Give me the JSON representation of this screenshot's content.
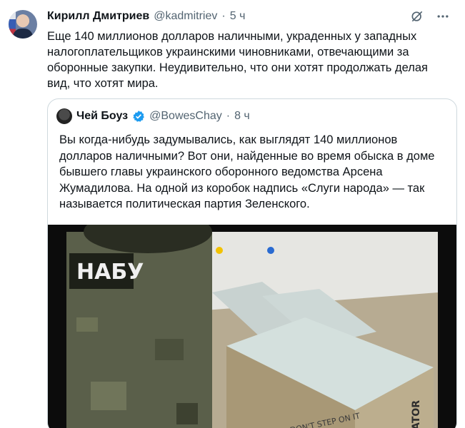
{
  "tweet": {
    "author_name": "Кирилл Дмитриев",
    "author_handle": "@kadmitriev",
    "separator": "·",
    "time": "5 ч",
    "text": "Еще 140 миллионов долларов наличными, украденных у западных налогоплательщиков украинскими чиновниками, отвечающими за оборонные закупки. Неудивительно, что они хотят продолжать делая вид, что хотят мира."
  },
  "quote": {
    "author_name": "Чей Боуз",
    "author_handle": "@BowesChay",
    "separator": "·",
    "time": "8 ч",
    "verified": true,
    "text": "Вы когда-нибудь задумывались, как выглядят 140 миллионов долларов наличными? Вот они, найденные во время обыска в доме бывшего главы украинского оборонного ведомства Арсена Жумадилова. На одной из коробок надпись «Слуги народа» — так называется политическая партия Зеленского.",
    "media": {
      "patch_text": "НАБУ",
      "box_text": "DON'T STEP ON IT",
      "box_text_2": "ATOR"
    }
  },
  "icons": {
    "grok": "grok-icon",
    "more": "more-icon",
    "verified": "verified-badge-icon"
  },
  "colors": {
    "text": "#0f1419",
    "secondary": "#536471",
    "border": "#cfd9de",
    "verified": "#1d9bf0"
  }
}
